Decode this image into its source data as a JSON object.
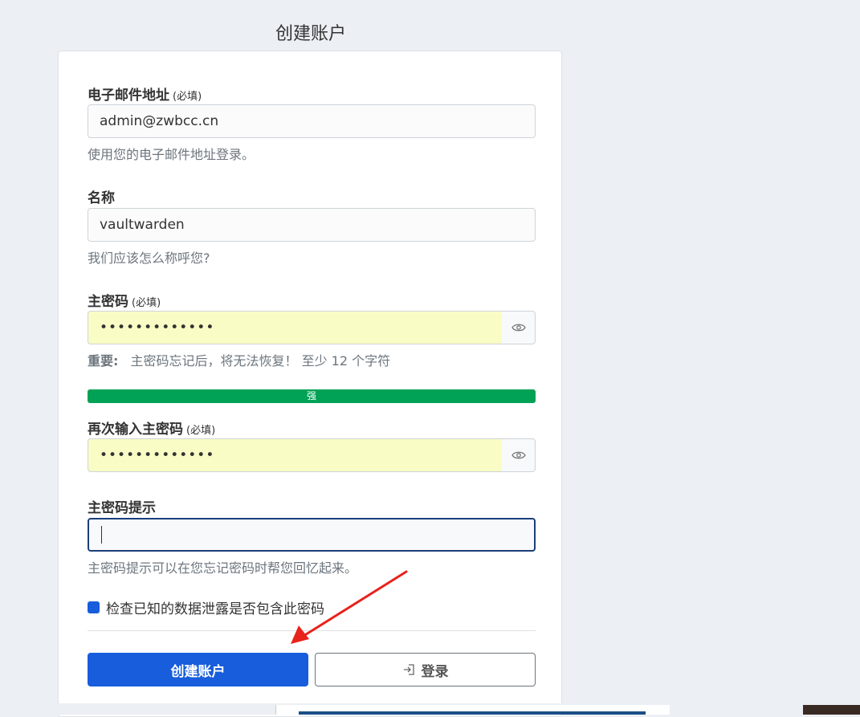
{
  "page": {
    "title": "创建账户"
  },
  "form": {
    "email": {
      "label": "电子邮件地址",
      "required": "(必填)",
      "value": "admin@zwbcc.cn",
      "help": "使用您的电子邮件地址登录。"
    },
    "name": {
      "label": "名称",
      "value": "vaultwarden",
      "help": "我们应该怎么称呼您?"
    },
    "master_password": {
      "label": "主密码",
      "required": "(必填)",
      "value": "•••••••••••••",
      "help_strong": "重要:",
      "help": "主密码忘记后，将无法恢复！ 至少 12 个字符",
      "strength": "强",
      "strength_color": "#01a255"
    },
    "confirm_password": {
      "label": "再次输入主密码",
      "required": "(必填)",
      "value": "•••••••••••••"
    },
    "hint": {
      "label": "主密码提示",
      "value": "",
      "help": "主密码提示可以在您忘记密码时帮您回忆起来。"
    },
    "breach_check": {
      "label": "检查已知的数据泄露是否包含此密码",
      "checked": true
    },
    "buttons": {
      "create": "创建账户",
      "login": "登录"
    }
  },
  "colors": {
    "primary": "#175ddc",
    "password_bg": "#f9fcc4",
    "annotation_arrow": "#e8231c"
  },
  "icons": {
    "password_toggle": "eye-icon",
    "login": "sign-in-icon"
  }
}
